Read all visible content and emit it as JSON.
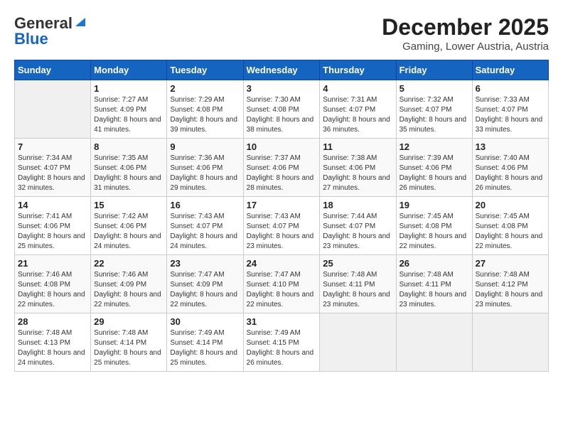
{
  "header": {
    "logo": {
      "general": "General",
      "blue": "Blue",
      "tagline": "GeneralBlue"
    },
    "title": "December 2025",
    "location": "Gaming, Lower Austria, Austria"
  },
  "weekdays": [
    "Sunday",
    "Monday",
    "Tuesday",
    "Wednesday",
    "Thursday",
    "Friday",
    "Saturday"
  ],
  "weeks": [
    [
      {
        "day": "",
        "sunrise": "",
        "sunset": "",
        "daylight": "",
        "empty": true
      },
      {
        "day": "1",
        "sunrise": "Sunrise: 7:27 AM",
        "sunset": "Sunset: 4:09 PM",
        "daylight": "Daylight: 8 hours and 41 minutes."
      },
      {
        "day": "2",
        "sunrise": "Sunrise: 7:29 AM",
        "sunset": "Sunset: 4:08 PM",
        "daylight": "Daylight: 8 hours and 39 minutes."
      },
      {
        "day": "3",
        "sunrise": "Sunrise: 7:30 AM",
        "sunset": "Sunset: 4:08 PM",
        "daylight": "Daylight: 8 hours and 38 minutes."
      },
      {
        "day": "4",
        "sunrise": "Sunrise: 7:31 AM",
        "sunset": "Sunset: 4:07 PM",
        "daylight": "Daylight: 8 hours and 36 minutes."
      },
      {
        "day": "5",
        "sunrise": "Sunrise: 7:32 AM",
        "sunset": "Sunset: 4:07 PM",
        "daylight": "Daylight: 8 hours and 35 minutes."
      },
      {
        "day": "6",
        "sunrise": "Sunrise: 7:33 AM",
        "sunset": "Sunset: 4:07 PM",
        "daylight": "Daylight: 8 hours and 33 minutes."
      }
    ],
    [
      {
        "day": "7",
        "sunrise": "Sunrise: 7:34 AM",
        "sunset": "Sunset: 4:07 PM",
        "daylight": "Daylight: 8 hours and 32 minutes."
      },
      {
        "day": "8",
        "sunrise": "Sunrise: 7:35 AM",
        "sunset": "Sunset: 4:06 PM",
        "daylight": "Daylight: 8 hours and 31 minutes."
      },
      {
        "day": "9",
        "sunrise": "Sunrise: 7:36 AM",
        "sunset": "Sunset: 4:06 PM",
        "daylight": "Daylight: 8 hours and 29 minutes."
      },
      {
        "day": "10",
        "sunrise": "Sunrise: 7:37 AM",
        "sunset": "Sunset: 4:06 PM",
        "daylight": "Daylight: 8 hours and 28 minutes."
      },
      {
        "day": "11",
        "sunrise": "Sunrise: 7:38 AM",
        "sunset": "Sunset: 4:06 PM",
        "daylight": "Daylight: 8 hours and 27 minutes."
      },
      {
        "day": "12",
        "sunrise": "Sunrise: 7:39 AM",
        "sunset": "Sunset: 4:06 PM",
        "daylight": "Daylight: 8 hours and 26 minutes."
      },
      {
        "day": "13",
        "sunrise": "Sunrise: 7:40 AM",
        "sunset": "Sunset: 4:06 PM",
        "daylight": "Daylight: 8 hours and 26 minutes."
      }
    ],
    [
      {
        "day": "14",
        "sunrise": "Sunrise: 7:41 AM",
        "sunset": "Sunset: 4:06 PM",
        "daylight": "Daylight: 8 hours and 25 minutes."
      },
      {
        "day": "15",
        "sunrise": "Sunrise: 7:42 AM",
        "sunset": "Sunset: 4:06 PM",
        "daylight": "Daylight: 8 hours and 24 minutes."
      },
      {
        "day": "16",
        "sunrise": "Sunrise: 7:43 AM",
        "sunset": "Sunset: 4:07 PM",
        "daylight": "Daylight: 8 hours and 24 minutes."
      },
      {
        "day": "17",
        "sunrise": "Sunrise: 7:43 AM",
        "sunset": "Sunset: 4:07 PM",
        "daylight": "Daylight: 8 hours and 23 minutes."
      },
      {
        "day": "18",
        "sunrise": "Sunrise: 7:44 AM",
        "sunset": "Sunset: 4:07 PM",
        "daylight": "Daylight: 8 hours and 23 minutes."
      },
      {
        "day": "19",
        "sunrise": "Sunrise: 7:45 AM",
        "sunset": "Sunset: 4:08 PM",
        "daylight": "Daylight: 8 hours and 22 minutes."
      },
      {
        "day": "20",
        "sunrise": "Sunrise: 7:45 AM",
        "sunset": "Sunset: 4:08 PM",
        "daylight": "Daylight: 8 hours and 22 minutes."
      }
    ],
    [
      {
        "day": "21",
        "sunrise": "Sunrise: 7:46 AM",
        "sunset": "Sunset: 4:08 PM",
        "daylight": "Daylight: 8 hours and 22 minutes."
      },
      {
        "day": "22",
        "sunrise": "Sunrise: 7:46 AM",
        "sunset": "Sunset: 4:09 PM",
        "daylight": "Daylight: 8 hours and 22 minutes."
      },
      {
        "day": "23",
        "sunrise": "Sunrise: 7:47 AM",
        "sunset": "Sunset: 4:09 PM",
        "daylight": "Daylight: 8 hours and 22 minutes."
      },
      {
        "day": "24",
        "sunrise": "Sunrise: 7:47 AM",
        "sunset": "Sunset: 4:10 PM",
        "daylight": "Daylight: 8 hours and 22 minutes."
      },
      {
        "day": "25",
        "sunrise": "Sunrise: 7:48 AM",
        "sunset": "Sunset: 4:11 PM",
        "daylight": "Daylight: 8 hours and 23 minutes."
      },
      {
        "day": "26",
        "sunrise": "Sunrise: 7:48 AM",
        "sunset": "Sunset: 4:11 PM",
        "daylight": "Daylight: 8 hours and 23 minutes."
      },
      {
        "day": "27",
        "sunrise": "Sunrise: 7:48 AM",
        "sunset": "Sunset: 4:12 PM",
        "daylight": "Daylight: 8 hours and 23 minutes."
      }
    ],
    [
      {
        "day": "28",
        "sunrise": "Sunrise: 7:48 AM",
        "sunset": "Sunset: 4:13 PM",
        "daylight": "Daylight: 8 hours and 24 minutes."
      },
      {
        "day": "29",
        "sunrise": "Sunrise: 7:48 AM",
        "sunset": "Sunset: 4:14 PM",
        "daylight": "Daylight: 8 hours and 25 minutes."
      },
      {
        "day": "30",
        "sunrise": "Sunrise: 7:49 AM",
        "sunset": "Sunset: 4:14 PM",
        "daylight": "Daylight: 8 hours and 25 minutes."
      },
      {
        "day": "31",
        "sunrise": "Sunrise: 7:49 AM",
        "sunset": "Sunset: 4:15 PM",
        "daylight": "Daylight: 8 hours and 26 minutes."
      },
      {
        "day": "",
        "sunrise": "",
        "sunset": "",
        "daylight": "",
        "empty": true
      },
      {
        "day": "",
        "sunrise": "",
        "sunset": "",
        "daylight": "",
        "empty": true
      },
      {
        "day": "",
        "sunrise": "",
        "sunset": "",
        "daylight": "",
        "empty": true
      }
    ]
  ]
}
